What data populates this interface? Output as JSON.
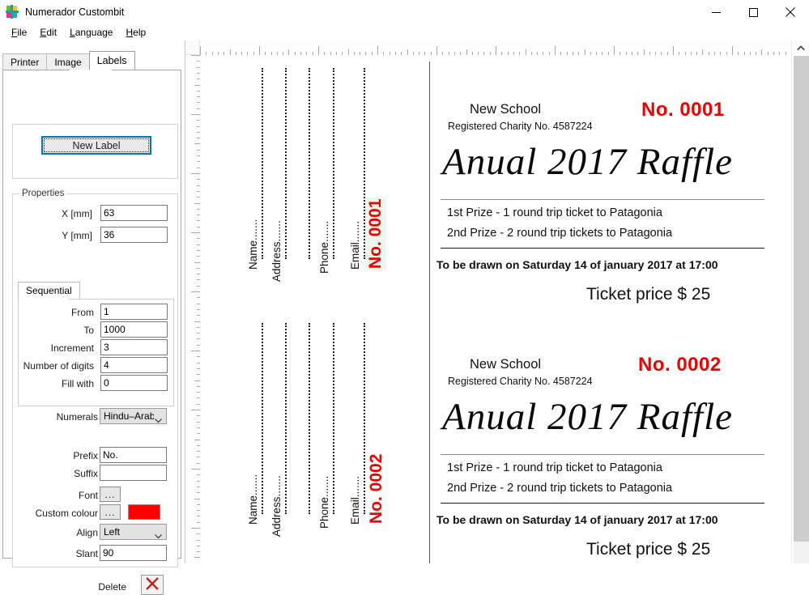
{
  "window": {
    "title": "Numerador Custombit",
    "icon": "app-logo-icon",
    "minimize_label": "—",
    "maximize_label": "□",
    "close_label": "✕"
  },
  "menu": {
    "items": [
      {
        "label": "File",
        "accel": "F"
      },
      {
        "label": "Edit",
        "accel": "E"
      },
      {
        "label": "Language",
        "accel": "L"
      },
      {
        "label": "Help",
        "accel": "H"
      }
    ]
  },
  "tabs": {
    "items": [
      {
        "label": "Printer",
        "active": false
      },
      {
        "label": "Image",
        "active": false
      },
      {
        "label": "Labels",
        "active": true
      }
    ]
  },
  "panel": {
    "new_label_button": "New Label",
    "properties_group_title": "Properties",
    "x_label": "X [mm]",
    "x_value": "63",
    "y_label": "Y [mm]",
    "y_value": "36",
    "sequential_tab": "Sequential",
    "from_label": "From",
    "from_value": "1",
    "to_label": "To",
    "to_value": "1000",
    "increment_label": "Increment",
    "increment_value": "3",
    "digits_label": "Number of digits",
    "digits_value": "4",
    "fill_label": "Fill with",
    "fill_value": "0",
    "numerals_label": "Numerals",
    "numerals_value": "Hindu–Arab",
    "prefix_label": "Prefix",
    "prefix_value": "No.",
    "suffix_label": "Suffix",
    "suffix_value": "",
    "font_label": "Font",
    "font_button": "...",
    "colour_label": "Custom colour",
    "colour_button": "...",
    "colour_value": "#FF0000",
    "align_label": "Align",
    "align_value": "Left",
    "slant_label": "Slant",
    "slant_value": "90",
    "delete_label": "Delete",
    "delete_icon": "red-x-icon"
  },
  "canvas": {
    "scroll_up_icon": "chevron-up-icon",
    "accent_red": "#EE0000",
    "tickets": [
      {
        "number_text": "No. 0001",
        "selected": true,
        "stub_labels": [
          "Name",
          "Address",
          "",
          "Phone",
          "Email"
        ],
        "org": "New School",
        "charity": "Registered Charity No. 4587224",
        "title": "Anual 2017 Raffle",
        "prize1": "1st Prize - 1 round trip ticket to Patagonia",
        "prize2": "2nd Prize - 2 round trip tickets to Patagonia",
        "drawn": "To be drawn on Saturday 14 of january 2017 at 17:00",
        "price": "Ticket price $ 25"
      },
      {
        "number_text": "No. 0002",
        "selected": false,
        "stub_labels": [
          "Name",
          "Address",
          "",
          "Phone",
          "Email"
        ],
        "org": "New School",
        "charity": "Registered Charity No. 4587224",
        "title": "Anual 2017 Raffle",
        "prize1": "1st Prize - 1 round trip ticket to Patagonia",
        "prize2": "2nd Prize - 2 round trip tickets to Patagonia",
        "drawn": "To be drawn on Saturday 14 of january 2017 at 17:00",
        "price": "Ticket price $ 25"
      }
    ]
  }
}
